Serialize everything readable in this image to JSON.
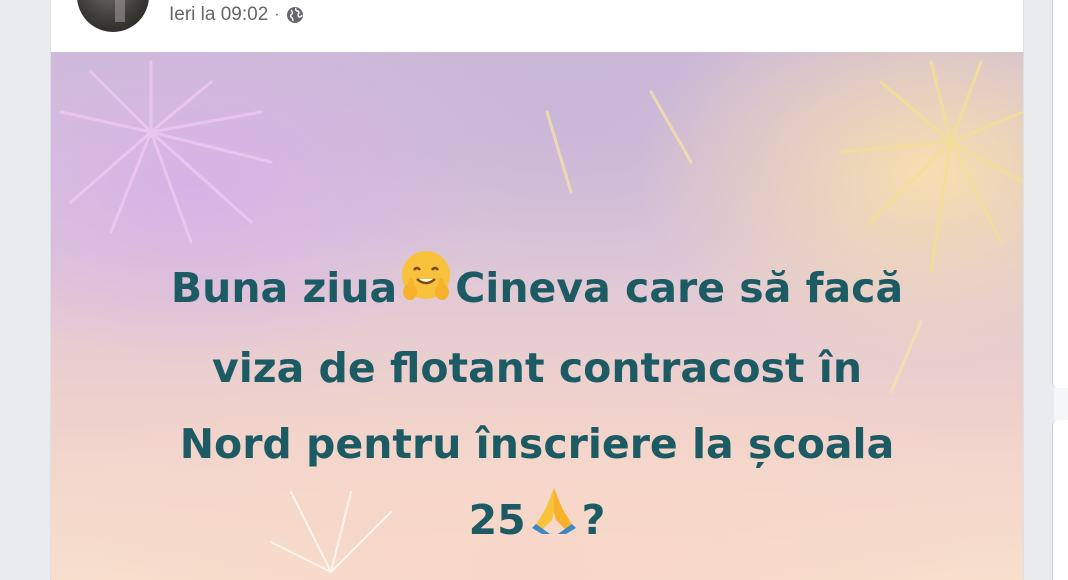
{
  "post": {
    "timestamp": "Ieri la 09:02",
    "separator": "·",
    "privacy_icon": "globe-icon",
    "text": {
      "line1_before_emoji": "Buna ziua",
      "line1_emoji": "hugging-face-emoji",
      "line1_after_emoji": "Cineva care să facă",
      "line2": "viza de flotant contracost în",
      "line3": "Nord pentru înscriere la școala",
      "line4_before_emoji": "25",
      "line4_emoji": "folded-hands-emoji",
      "line4_after_emoji": "?"
    },
    "background_theme": "fireworks",
    "text_color": "#1c5b63"
  },
  "colors": {
    "meta_text": "#65676b",
    "card_background": "#ffffff",
    "page_background": "#e9ebee"
  }
}
